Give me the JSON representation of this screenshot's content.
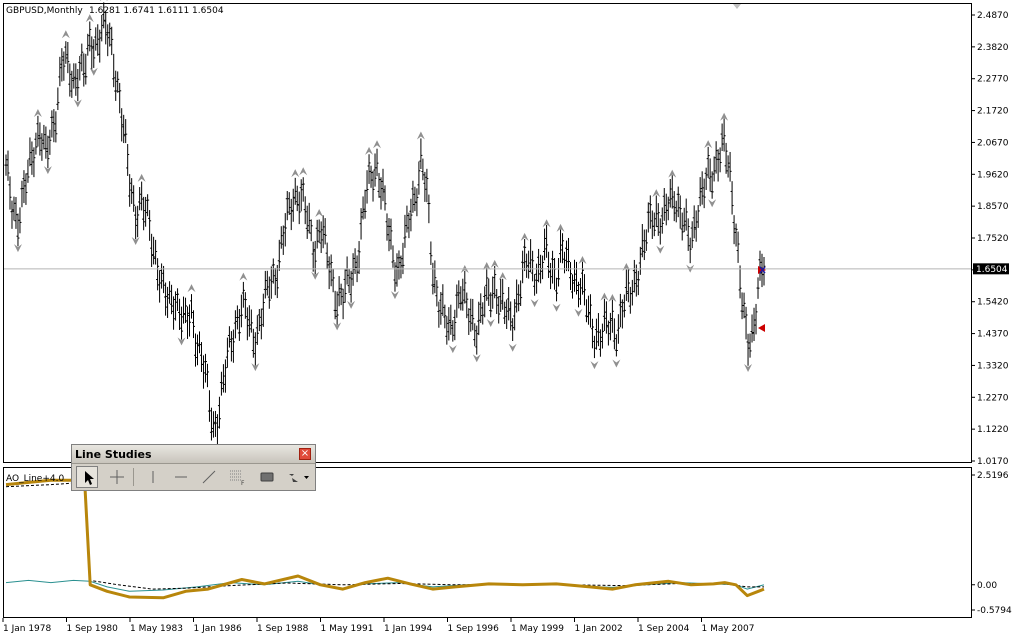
{
  "header": {
    "symbol": "GBPUSD,Monthly",
    "ohlc": "1.6281 1.6741 1.6111 1.6504"
  },
  "price_axis": {
    "ticks": [
      "2.4870",
      "2.3820",
      "2.2770",
      "2.1720",
      "2.0670",
      "1.9620",
      "1.8570",
      "1.7520",
      "1.6470",
      "1.5420",
      "1.4370",
      "1.3320",
      "1.2270",
      "1.1220",
      "1.0170"
    ],
    "current_price_label": "1.6504"
  },
  "indicator": {
    "name": "AO_Line+4.0",
    "ticks": [
      "2.5196",
      "0.00",
      "-0.57945"
    ]
  },
  "time_axis": {
    "labels": [
      "1 Jan 1978",
      "1 Sep 1980",
      "1 May 1983",
      "1 Jan 1986",
      "1 Sep 1988",
      "1 May 1991",
      "1 Jan 1994",
      "1 Sep 1996",
      "1 May 1999",
      "1 Jan 2002",
      "1 Sep 2004",
      "1 May 2007"
    ]
  },
  "line_studies": {
    "title": "Line Studies",
    "close_glyph": "×",
    "tools": [
      "cursor-icon",
      "crosshair-icon",
      "vertical-line-icon",
      "horizontal-line-icon",
      "trendline-icon",
      "fibonacci-icon",
      "rectangle-icon",
      "arrows-dropdown-icon"
    ]
  },
  "colors": {
    "background": "#ffffff",
    "bars": "#000000",
    "fractal_arrows": "#909090",
    "current_price_line": "#b4b4b4",
    "indicator_main": "#b8860b",
    "indicator_teal": "#2a9090",
    "indicator_signal": "#000000"
  },
  "chart_data": {
    "type": "bar",
    "price_series": [
      [
        0,
        1.97
      ],
      [
        1,
        1.86
      ],
      [
        2,
        1.82
      ],
      [
        3,
        1.88
      ],
      [
        4,
        1.96
      ],
      [
        5,
        2.05
      ],
      [
        6,
        2.12
      ],
      [
        7,
        2.02
      ],
      [
        8,
        2.07
      ],
      [
        9,
        2.19
      ],
      [
        10,
        2.35
      ],
      [
        11,
        2.3
      ],
      [
        12,
        2.26
      ],
      [
        13,
        2.33
      ],
      [
        14,
        2.3
      ],
      [
        15,
        2.38
      ],
      [
        16,
        2.4
      ],
      [
        17,
        2.45
      ],
      [
        18,
        2.42
      ],
      [
        19,
        2.36
      ],
      [
        20,
        2.25
      ],
      [
        21,
        2.1
      ],
      [
        22,
        1.93
      ],
      [
        23,
        1.84
      ],
      [
        24,
        1.88
      ],
      [
        25,
        1.82
      ],
      [
        26,
        1.74
      ],
      [
        27,
        1.67
      ],
      [
        28,
        1.58
      ],
      [
        29,
        1.52
      ],
      [
        30,
        1.56
      ],
      [
        31,
        1.52
      ],
      [
        32,
        1.46
      ],
      [
        33,
        1.5
      ],
      [
        34,
        1.42
      ],
      [
        35,
        1.35
      ],
      [
        36,
        1.23
      ],
      [
        37,
        1.12
      ],
      [
        38,
        1.2
      ],
      [
        39,
        1.3
      ],
      [
        40,
        1.4
      ],
      [
        41,
        1.48
      ],
      [
        42,
        1.53
      ],
      [
        43,
        1.48
      ],
      [
        44,
        1.43
      ],
      [
        45,
        1.46
      ],
      [
        46,
        1.53
      ],
      [
        47,
        1.6
      ],
      [
        48,
        1.64
      ],
      [
        49,
        1.72
      ],
      [
        50,
        1.8
      ],
      [
        51,
        1.88
      ],
      [
        52,
        1.91
      ],
      [
        53,
        1.86
      ],
      [
        54,
        1.78
      ],
      [
        55,
        1.72
      ],
      [
        56,
        1.8
      ],
      [
        57,
        1.7
      ],
      [
        58,
        1.62
      ],
      [
        59,
        1.56
      ],
      [
        60,
        1.55
      ],
      [
        61,
        1.6
      ],
      [
        62,
        1.66
      ],
      [
        63,
        1.73
      ],
      [
        64,
        1.88
      ],
      [
        65,
        1.96
      ],
      [
        66,
        2.0
      ],
      [
        67,
        1.9
      ],
      [
        68,
        1.78
      ],
      [
        69,
        1.7
      ],
      [
        70,
        1.64
      ],
      [
        71,
        1.72
      ],
      [
        72,
        1.84
      ],
      [
        73,
        1.91
      ],
      [
        74,
        2.0
      ],
      [
        75,
        1.88
      ],
      [
        76,
        1.66
      ],
      [
        77,
        1.55
      ],
      [
        78,
        1.48
      ],
      [
        79,
        1.44
      ],
      [
        80,
        1.52
      ],
      [
        81,
        1.58
      ],
      [
        82,
        1.51
      ],
      [
        83,
        1.49
      ],
      [
        84,
        1.46
      ],
      [
        85,
        1.52
      ],
      [
        86,
        1.56
      ],
      [
        87,
        1.6
      ],
      [
        88,
        1.54
      ],
      [
        89,
        1.5
      ],
      [
        90,
        1.49
      ],
      [
        91,
        1.55
      ],
      [
        92,
        1.62
      ],
      [
        93,
        1.68
      ],
      [
        94,
        1.66
      ],
      [
        95,
        1.63
      ],
      [
        96,
        1.7
      ],
      [
        97,
        1.66
      ],
      [
        98,
        1.63
      ],
      [
        99,
        1.7
      ],
      [
        100,
        1.66
      ],
      [
        101,
        1.64
      ],
      [
        102,
        1.6
      ],
      [
        103,
        1.55
      ],
      [
        104,
        1.49
      ],
      [
        105,
        1.44
      ],
      [
        106,
        1.42
      ],
      [
        107,
        1.46
      ],
      [
        108,
        1.48
      ],
      [
        109,
        1.44
      ],
      [
        110,
        1.52
      ],
      [
        111,
        1.58
      ],
      [
        112,
        1.62
      ],
      [
        113,
        1.66
      ],
      [
        114,
        1.75
      ],
      [
        115,
        1.85
      ],
      [
        116,
        1.82
      ],
      [
        117,
        1.78
      ],
      [
        118,
        1.88
      ],
      [
        119,
        1.91
      ],
      [
        120,
        1.82
      ],
      [
        121,
        1.78
      ],
      [
        122,
        1.75
      ],
      [
        123,
        1.84
      ],
      [
        124,
        1.88
      ],
      [
        125,
        1.96
      ],
      [
        126,
        1.99
      ],
      [
        127,
        2.02
      ],
      [
        128,
        2.05
      ],
      [
        129,
        1.96
      ],
      [
        130,
        1.78
      ],
      [
        131,
        1.55
      ],
      [
        132,
        1.4
      ],
      [
        133,
        1.45
      ],
      [
        134,
        1.6
      ],
      [
        135,
        1.65
      ]
    ],
    "x_range": [
      0,
      135
    ],
    "ylim": [
      1.017,
      2.487
    ],
    "current_price": 1.6504,
    "indicator_ylim": [
      -0.57945,
      2.5196
    ],
    "indicator_main": [
      [
        0,
        2.3
      ],
      [
        4,
        2.35
      ],
      [
        8,
        2.4
      ],
      [
        14,
        2.4
      ],
      [
        15,
        0.0
      ],
      [
        18,
        -0.15
      ],
      [
        22,
        -0.28
      ],
      [
        28,
        -0.3
      ],
      [
        32,
        -0.15
      ],
      [
        36,
        -0.1
      ],
      [
        42,
        0.12
      ],
      [
        46,
        0.02
      ],
      [
        52,
        0.2
      ],
      [
        56,
        0.0
      ],
      [
        60,
        -0.1
      ],
      [
        64,
        0.05
      ],
      [
        68,
        0.15
      ],
      [
        72,
        0.02
      ],
      [
        76,
        -0.1
      ],
      [
        80,
        -0.05
      ],
      [
        86,
        0.02
      ],
      [
        92,
        0.0
      ],
      [
        98,
        0.02
      ],
      [
        104,
        -0.05
      ],
      [
        108,
        -0.1
      ],
      [
        112,
        0.0
      ],
      [
        118,
        0.08
      ],
      [
        122,
        0.0
      ],
      [
        126,
        0.02
      ],
      [
        128,
        0.05
      ],
      [
        130,
        0.0
      ],
      [
        132,
        -0.25
      ],
      [
        134,
        -0.15
      ],
      [
        135,
        -0.1
      ]
    ],
    "indicator_teal": [
      [
        0,
        0.05
      ],
      [
        4,
        0.1
      ],
      [
        8,
        0.05
      ],
      [
        12,
        0.1
      ],
      [
        15,
        0.08
      ],
      [
        18,
        -0.05
      ],
      [
        22,
        -0.15
      ],
      [
        28,
        -0.12
      ],
      [
        34,
        -0.05
      ],
      [
        40,
        0.05
      ],
      [
        46,
        0.0
      ],
      [
        52,
        0.08
      ],
      [
        56,
        0.0
      ],
      [
        60,
        -0.08
      ],
      [
        64,
        0.02
      ],
      [
        70,
        0.05
      ],
      [
        76,
        -0.05
      ],
      [
        82,
        0.0
      ],
      [
        88,
        0.02
      ],
      [
        94,
        0.0
      ],
      [
        100,
        0.01
      ],
      [
        104,
        -0.04
      ],
      [
        108,
        -0.06
      ],
      [
        114,
        0.0
      ],
      [
        120,
        0.05
      ],
      [
        126,
        0.02
      ],
      [
        130,
        0.0
      ],
      [
        132,
        -0.1
      ],
      [
        135,
        0.0
      ]
    ],
    "indicator_signal": [
      [
        0,
        2.25
      ],
      [
        8,
        2.3
      ],
      [
        14,
        2.35
      ],
      [
        15,
        0.1
      ],
      [
        20,
        0.0
      ],
      [
        26,
        -0.1
      ],
      [
        32,
        -0.08
      ],
      [
        40,
        -0.02
      ],
      [
        50,
        0.04
      ],
      [
        60,
        0.0
      ],
      [
        70,
        0.03
      ],
      [
        80,
        0.0
      ],
      [
        90,
        0.0
      ],
      [
        100,
        0.0
      ],
      [
        110,
        -0.02
      ],
      [
        120,
        0.03
      ],
      [
        128,
        0.02
      ],
      [
        132,
        -0.05
      ],
      [
        135,
        -0.05
      ]
    ]
  }
}
